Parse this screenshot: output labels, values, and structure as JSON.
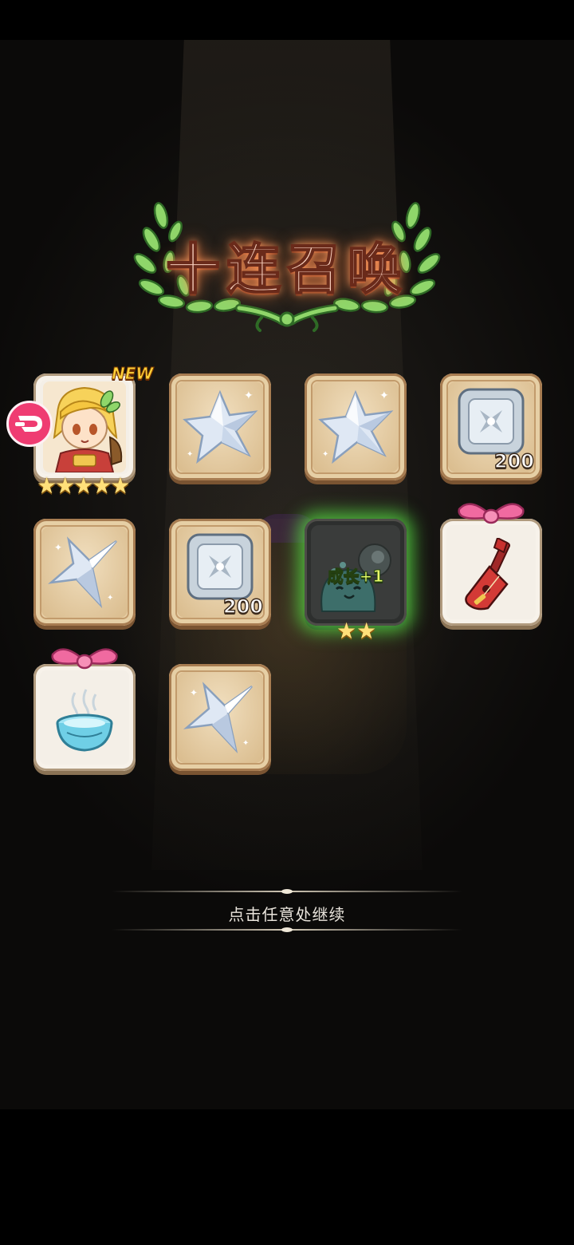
{
  "title": "十连召唤",
  "new_label": "NEW",
  "continue_text": "点击任意处继续",
  "items": [
    {
      "name": "hero-portrait",
      "stars": "★★★★★",
      "is_new": true
    },
    {
      "name": "crystal-star-shard"
    },
    {
      "name": "crystal-star-shard"
    },
    {
      "name": "stone-rune-tile",
      "count": "200"
    },
    {
      "name": "crystal-star"
    },
    {
      "name": "stone-rune-tile",
      "count": "200"
    },
    {
      "name": "slime-pet",
      "label": "成长+1",
      "stars": "★★"
    },
    {
      "name": "red-lute-gift"
    },
    {
      "name": "water-bowl-gift"
    },
    {
      "name": "crystal-star"
    }
  ]
}
